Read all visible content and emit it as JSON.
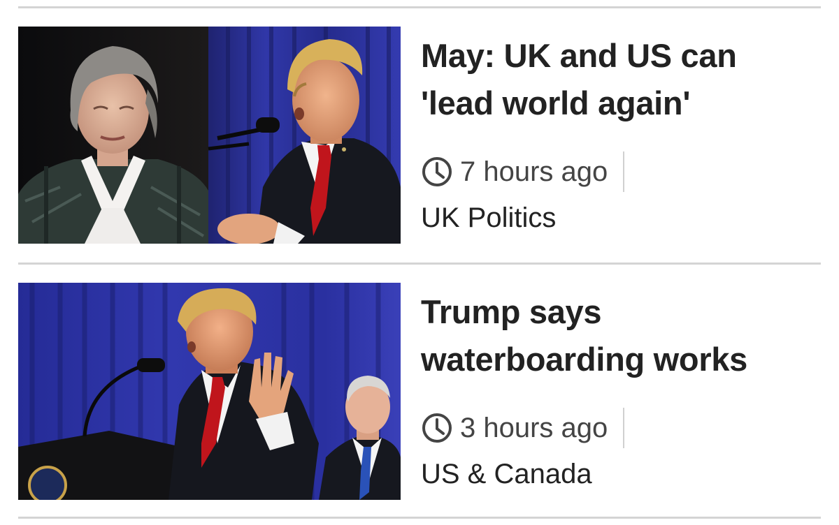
{
  "stories": [
    {
      "headline": "May: UK and US can 'lead world again'",
      "time": "7 hours ago",
      "section": "UK Politics",
      "image": "photo-theresa-may-and-donald-trump"
    },
    {
      "headline": "Trump says waterboarding works",
      "time": "3 hours ago",
      "section": "US & Canada",
      "image": "photo-trump-at-podium-with-pence"
    }
  ],
  "colors": {
    "headline": "#222222",
    "meta": "#444444",
    "divider": "#d4d4d4",
    "curtain_blue": "#2a2f9a",
    "tie_red": "#c0151c"
  },
  "icons": [
    "clock-icon"
  ]
}
